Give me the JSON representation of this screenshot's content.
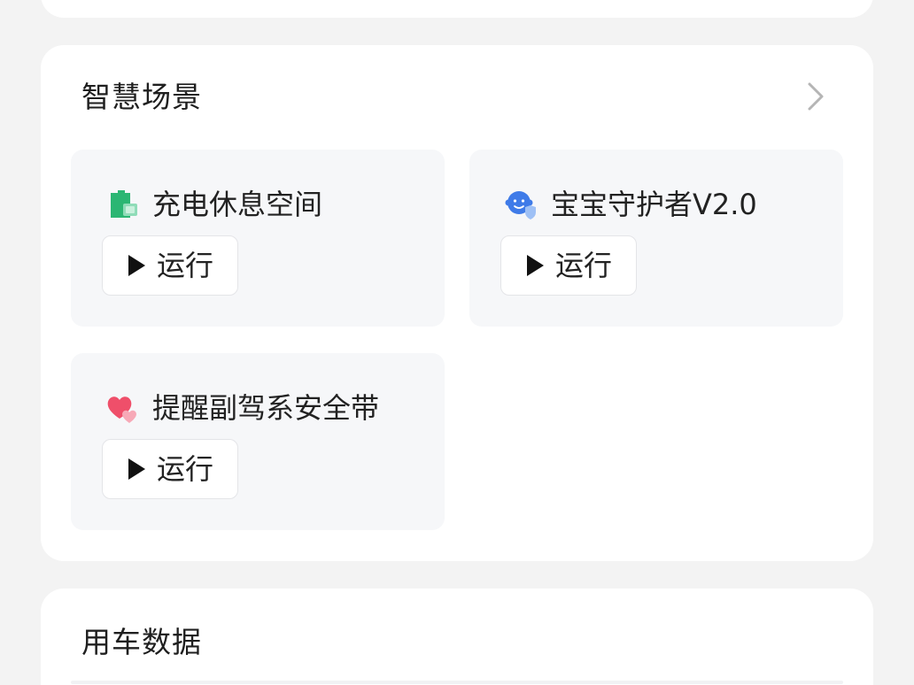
{
  "scenes_section": {
    "title": "智慧场景",
    "more_icon": "chevron-right-icon",
    "items": [
      {
        "name": "充电休息空间",
        "icon": "charging-rest-icon",
        "icon_color": "#2bb673",
        "run_label": "运行"
      },
      {
        "name": "宝宝守护者V2.0",
        "icon": "baby-guardian-icon",
        "icon_color": "#3f7be8",
        "run_label": "运行"
      },
      {
        "name": "提醒副驾系安全带",
        "icon": "heart-icon",
        "icon_color": "#ef4f6a",
        "run_label": "运行"
      }
    ]
  },
  "data_section": {
    "title": "用车数据"
  },
  "colors": {
    "background": "#f3f3f3",
    "card": "#ffffff",
    "scene_tile": "#f6f7f9"
  }
}
